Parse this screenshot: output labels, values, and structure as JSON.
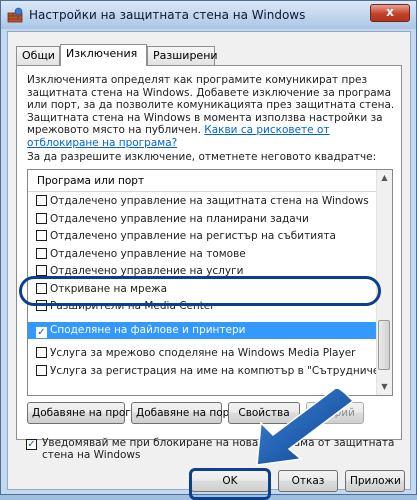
{
  "window": {
    "title": "Настройки на защитната стена на Windows",
    "close_label": "x"
  },
  "tabs": [
    {
      "label": "Общи"
    },
    {
      "label": "Изключения",
      "active": true
    },
    {
      "label": "Разширени"
    }
  ],
  "exceptions": {
    "description": "Изключенията определят как програмите комуникират през защитната стена на Windows. Добавете изключение за програма или порт, за да позволите комуникацията през защитната стена.",
    "risk_text": "Защитната стена на Windows в момента използва настройки за мрежовото място на публичен.",
    "risk_link": "Какви са рисковете от отблокиране на програма?",
    "list_caption": "За да разрешите изключение, отметнете неговото квадратче:",
    "column_header": "Програма или порт",
    "items": [
      {
        "label": "Отдалечено управление на защитната стена на Windows",
        "checked": false
      },
      {
        "label": "Отдалечено управление на планирани задачи",
        "checked": false
      },
      {
        "label": "Отдалечено управление на регистър на събитията",
        "checked": false
      },
      {
        "label": "Отдалечено управление на томове",
        "checked": false
      },
      {
        "label": "Отдалечено управление на услуги",
        "checked": false
      },
      {
        "label": "Откриване на мрежа",
        "checked": false
      },
      {
        "label": "Разширители на Media Center",
        "checked": false
      },
      {
        "label": "Споделяне на файлове и принтери",
        "checked": true,
        "selected": true
      },
      {
        "label": "Услуга за мрежово споделяне на Windows Media Player",
        "checked": false
      },
      {
        "label": "Услуга за регистрация на име на компютър в \"Сътрудничество ...",
        "checked": false
      }
    ],
    "add_program_button": "Добавяне на програма...",
    "add_port_button": "Добавяне на порт...",
    "properties_button": "Свойства",
    "delete_button": "Изтрий",
    "notify_checked": true,
    "notify_label": "Уведомявай ме при блокиране на нова програма от защитната стена на Windows"
  },
  "buttons": {
    "ok": "OK",
    "cancel": "Отказ",
    "apply": "Приложи"
  },
  "colors": {
    "selection": "#3399ff",
    "highlight_ring": "#0d3f8f",
    "link": "#0066cc"
  }
}
